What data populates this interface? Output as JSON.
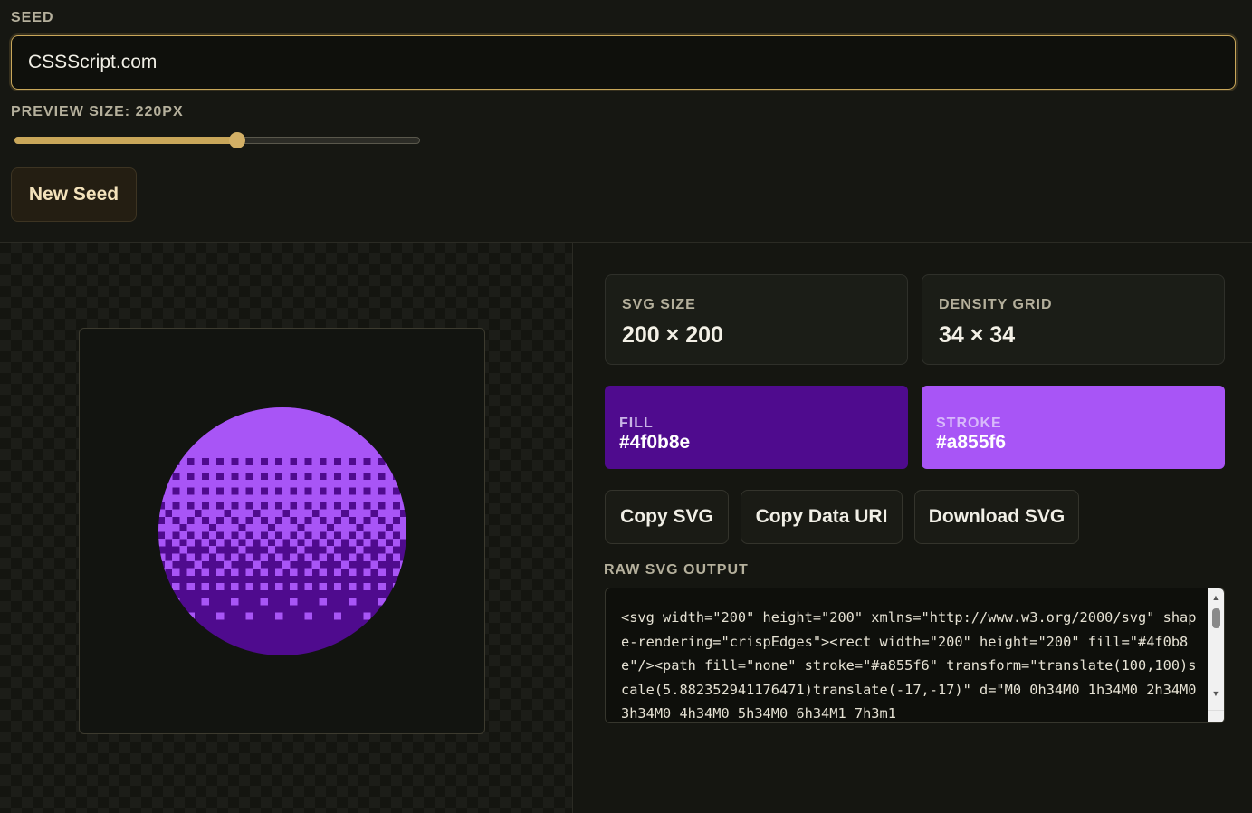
{
  "seed": {
    "label": "SEED",
    "value": "CSSScript.com"
  },
  "preview_size": {
    "label": "PREVIEW SIZE: 220PX",
    "slider_fraction": 0.55
  },
  "buttons": {
    "new_seed": "New Seed",
    "copy_svg": "Copy SVG",
    "copy_data_uri": "Copy Data URI",
    "download_svg": "Download SVG"
  },
  "stats": {
    "svg_size_label": "SVG SIZE",
    "svg_size_value": "200 × 200",
    "density_label": "DENSITY GRID",
    "density_value": "34 × 34"
  },
  "colors": {
    "fill_label": "FILL",
    "fill_value": "#4f0b8e",
    "stroke_label": "STROKE",
    "stroke_value": "#a855f6",
    "accent": "#c9a75a"
  },
  "raw_output": {
    "label": "RAW SVG OUTPUT",
    "code": "<svg width=\"200\" height=\"200\" xmlns=\"http://www.w3.org/2000/svg\" shape-rendering=\"crispEdges\"><rect width=\"200\" height=\"200\" fill=\"#4f0b8e\"/><path fill=\"none\" stroke=\"#a855f6\" transform=\"translate(100,100)scale(5.882352941176471)translate(-17,-17)\" d=\"M0 0h34M0 1h34M0 2h34M0 3h34M0 4h34M0 5h34M0 6h34M1 7h3m1"
  },
  "icons": {
    "scroll_up": "scroll-up-icon",
    "scroll_down": "scroll-down-icon"
  }
}
